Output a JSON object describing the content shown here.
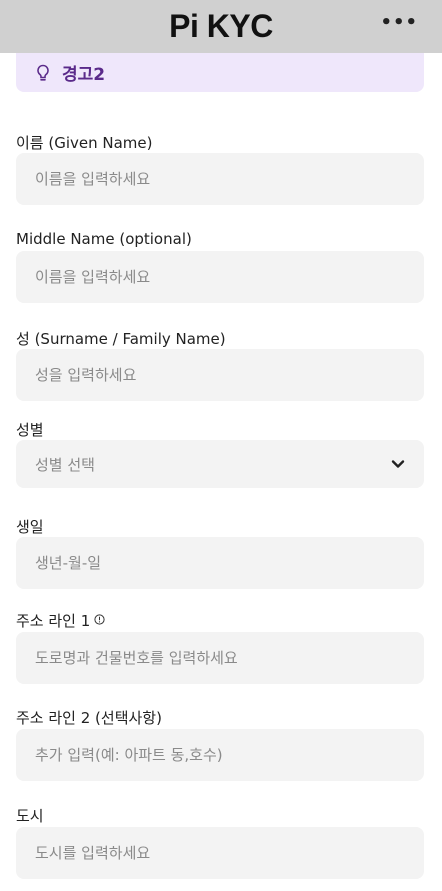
{
  "header": {
    "title": "Pi KYC",
    "menu_label": "•••"
  },
  "warning": {
    "text": "경고2"
  },
  "fields": {
    "given_name": {
      "label": "이름 (Given Name)",
      "placeholder": "이름을 입력하세요"
    },
    "middle_name": {
      "label": "Middle Name (optional)",
      "placeholder": "이름을 입력하세요"
    },
    "surname": {
      "label": "성 (Surname / Family Name)",
      "placeholder": "성을 입력하세요"
    },
    "gender": {
      "label": "성별",
      "selected": "성별 선택"
    },
    "birthdate": {
      "label": "생일",
      "placeholder": "생년-월-일"
    },
    "address1": {
      "label": "주소 라인 1",
      "placeholder": "도로명과 건물번호를 입력하세요"
    },
    "address2": {
      "label": "주소 라인 2 (선택사항)",
      "placeholder": "추가 입력(예: 아파트 동,호수)"
    },
    "city": {
      "label": "도시",
      "placeholder": "도시를 입력하세요"
    }
  },
  "colors": {
    "header_bg": "#d0d0d0",
    "warning_bg": "#efe7fb",
    "warning_text": "#5a2a8a",
    "input_bg": "#f3f3f3"
  }
}
